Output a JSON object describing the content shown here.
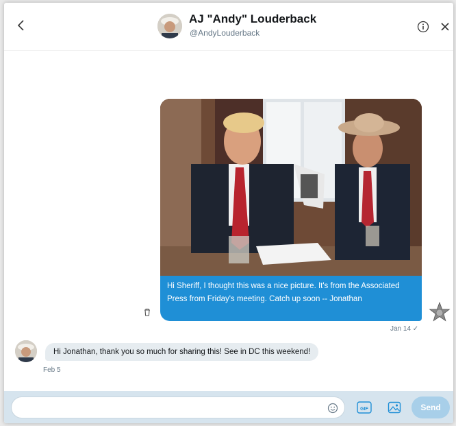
{
  "header": {
    "name": "AJ \"Andy\" Louderback",
    "handle": "@AndyLouderback"
  },
  "messages": {
    "outgoing": {
      "text": "Hi Sheriff, I thought this was a nice picture. It's from the Associated Press from Friday's meeting. Catch up soon -- Jonathan",
      "time": "Jan 14 ✓"
    },
    "incoming": {
      "text": "Hi Jonathan, thank you so much for sharing this!  See in DC this weekend!",
      "time": "Feb 5"
    }
  },
  "composer": {
    "placeholder": "",
    "gif_label": "GIF",
    "send_label": "Send"
  },
  "icons": {
    "back": "chevron-left-icon",
    "info": "info-icon",
    "close": "close-icon",
    "trash": "trash-icon",
    "emoji": "emoji-icon",
    "image": "image-icon"
  },
  "colors": {
    "accent": "#1f8fd6",
    "incoming_bubble": "#e6ecf0",
    "composer_bg": "#d6e4ee",
    "send_disabled": "#a8cfe9"
  }
}
